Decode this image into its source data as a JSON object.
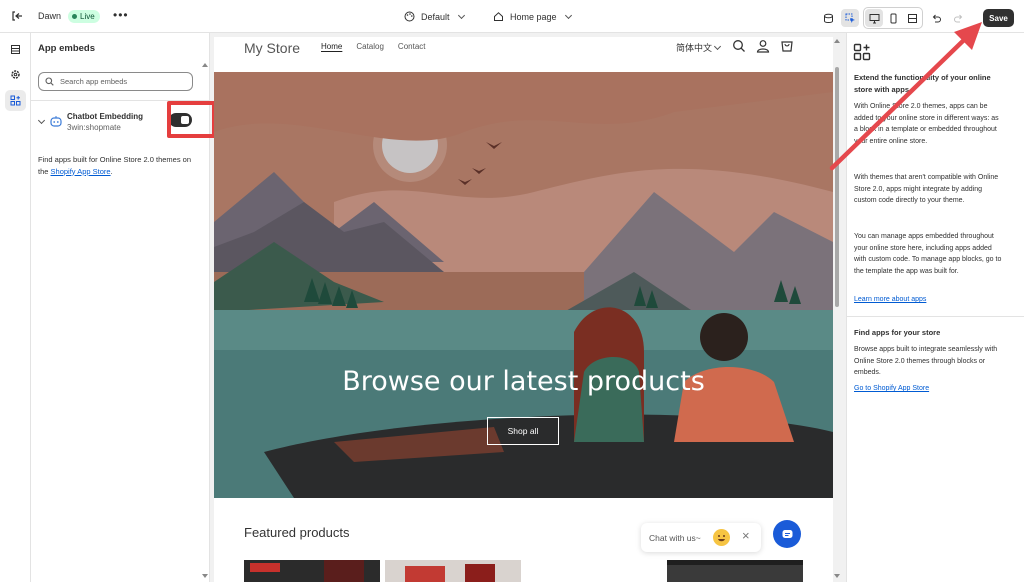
{
  "topbar": {
    "theme_name": "Dawn",
    "status_badge": "Live",
    "more_label": "•••",
    "preset_label": "Default",
    "page_label": "Home page",
    "save_label": "Save"
  },
  "sidebar": {
    "title": "App embeds",
    "search_placeholder": "Search app embeds",
    "embed": {
      "name": "Chatbot Embedding",
      "app": "3win:shopmate",
      "enabled": true
    },
    "help_text": "Find apps built for Online Store 2.0 themes on the ",
    "help_link": "Shopify App Store",
    "help_suffix": "."
  },
  "preview": {
    "store_name": "My Store",
    "nav": [
      "Home",
      "Catalog",
      "Contact"
    ],
    "language": "简体中文",
    "hero_title": "Browse our latest products",
    "hero_button": "Shop all",
    "featured_title": "Featured products",
    "chat_text": "Chat with us~",
    "chat_close": "×"
  },
  "right_panel": {
    "heading1": "Extend the functionality of your online store with apps",
    "para1": "With Online Store 2.0 themes, apps can be added to your online store in different ways: as a block in a template or embedded throughout your entire online store.",
    "para2": "With themes that aren't compatible with Online Store 2.0, apps might integrate by adding custom code directly to your theme.",
    "para3": "You can manage apps embedded throughout your online store here, including apps added with custom code. To manage app blocks, go to the template the app was built for.",
    "link1": "Learn more about apps",
    "heading2": "Find apps for your store",
    "para4": "Browse apps built to integrate seamlessly with Online Store 2.0 themes through blocks or embeds.",
    "link2": "Go to Shopify App Store"
  },
  "colors": {
    "annotation_red": "#e53e3e",
    "link_blue": "#005bd3",
    "chat_blue": "#1a5bd8"
  }
}
